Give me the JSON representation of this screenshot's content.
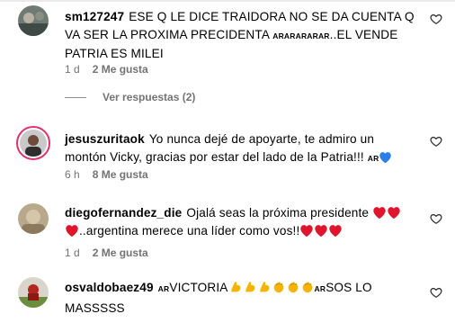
{
  "comments": [
    {
      "username": "sm127247",
      "text": "ESE Q LE DICE TRAIDORA NO SE DA CUENTA Q VA SER LA PROXIMA PRECIDENTA",
      "small_tag": "ARARARARAR",
      "text_after": "..EL VENDE PATRIA ES MILEI",
      "time": "1 d",
      "likes": "2 Me gusta"
    },
    {
      "username": "jesuszuritaok",
      "text": "Yo nunca dejé de apoyarte, te admiro un montón Vicky, gracias por estar del lado de la Patria!!!",
      "small_tag": "AR",
      "time": "6 h",
      "likes": "8 Me gusta"
    },
    {
      "username": "diegofernandez_die",
      "text": "Ojalá seas la próxima presidente",
      "text_mid": "..argentina merece una líder como vos!!",
      "time": "1 d",
      "likes": "2 Me gusta"
    },
    {
      "username": "osvaldobaez49",
      "tag_before": "AR",
      "text": "VICTORIA",
      "tag_after": "AR",
      "text_after": "SOS LO MASSSSS"
    }
  ],
  "replies_link": "Ver respuestas (2)",
  "icons": {
    "like": "heart-outline-icon",
    "heart": "red-heart-emoji",
    "blue_heart": "blue-heart-emoji",
    "muscle": "flexed-biceps-emoji",
    "clap": "clapping-hands-emoji"
  },
  "colors": {
    "meta": "#737373",
    "story_ring": "#e1306c",
    "red_heart": "#e0142d",
    "blue_heart": "#2b7de9",
    "emoji_yellow": "#f5b400"
  }
}
